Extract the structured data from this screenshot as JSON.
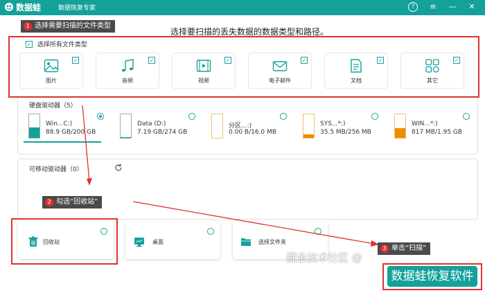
{
  "app": {
    "name": "数据蛙",
    "subtitle": "数据恢复专家",
    "brand_color": "#13a19a"
  },
  "window_controls": {
    "help": "?",
    "menu": "≡",
    "minimize": "—",
    "close": "✕"
  },
  "main_title": "选择要扫描的丢失数据的数据类型和路径。",
  "file_types": {
    "select_all_label": "选择所有文件类型",
    "select_all_checked": true,
    "items": [
      {
        "label": "图片",
        "icon": "image-icon",
        "checked": true
      },
      {
        "label": "音频",
        "icon": "music-icon",
        "checked": true
      },
      {
        "label": "视频",
        "icon": "video-icon",
        "checked": true
      },
      {
        "label": "电子邮件",
        "icon": "email-icon",
        "checked": true
      },
      {
        "label": "文档",
        "icon": "document-icon",
        "checked": true
      },
      {
        "label": "其它",
        "icon": "other-icon",
        "checked": true
      }
    ]
  },
  "hard_drives": {
    "title": "硬盘驱动器（5）",
    "items": [
      {
        "name": "Win...C:)",
        "size": "88.9 GB/200 GB",
        "selected": true,
        "fill": 0.44,
        "fill_color": "#13a19a"
      },
      {
        "name": "Data (D:)",
        "size": "7.19 GB/274 GB",
        "selected": false,
        "fill": 0.03,
        "fill_color": "#13a19a"
      },
      {
        "name": "分区...:)",
        "size": "0.00  B/16.0 MB",
        "selected": false,
        "fill": 0.0,
        "fill_color": "#f0a020"
      },
      {
        "name": "SYS...*:)",
        "size": "35.5 MB/256 MB",
        "selected": false,
        "fill": 0.14,
        "fill_color": "#f08a00"
      },
      {
        "name": "WIN...*:)",
        "size": "817 MB/1.95 GB",
        "selected": false,
        "fill": 0.42,
        "fill_color": "#f08a00"
      }
    ]
  },
  "removable": {
    "title": "可移动驱动器（0）",
    "refresh_icon": "refresh-icon"
  },
  "locations": [
    {
      "label": "回收站",
      "icon": "recycle-bin-icon"
    },
    {
      "label": "桌面",
      "icon": "desktop-icon"
    },
    {
      "label": "选择文件夹",
      "icon": "folder-icon"
    }
  ],
  "annotations": [
    {
      "number": "1",
      "text": "选择需要扫描的文件类型"
    },
    {
      "number": "2",
      "text": "勾选“回收站”"
    },
    {
      "number": "3",
      "text": "单击“扫描”"
    }
  ],
  "annotation_color": "#e03030",
  "scan_button": "数据蛙恢复软件",
  "watermark": "掘金技术社区 @"
}
